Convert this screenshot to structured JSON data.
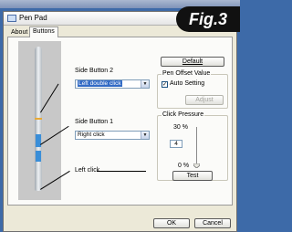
{
  "window": {
    "title": "Pen Pad",
    "figure_label": "Fig.3"
  },
  "tabs": [
    {
      "label": "About",
      "active": false
    },
    {
      "label": "Buttons",
      "active": true
    }
  ],
  "side_button_2": {
    "label": "Side Button 2",
    "value": "Left double click"
  },
  "side_button_1": {
    "label": "Side Button 1",
    "value": "Right click"
  },
  "tip_label": "Left click",
  "default_button": "Default",
  "pen_offset": {
    "title": "Pen Offset Value",
    "auto_setting_label": "Auto Setting",
    "auto_setting_checked": true,
    "adjust_button": "Adjust"
  },
  "click_pressure": {
    "title": "Click Pressure",
    "max_label": "30 %",
    "min_label": "0 %",
    "value": "4",
    "test_button": "Test"
  },
  "footer": {
    "ok_button": "OK",
    "cancel_button": "Cancel"
  },
  "colors": {
    "pen_accent": "#e7a936",
    "pen_blue": "#3a8ed8"
  }
}
